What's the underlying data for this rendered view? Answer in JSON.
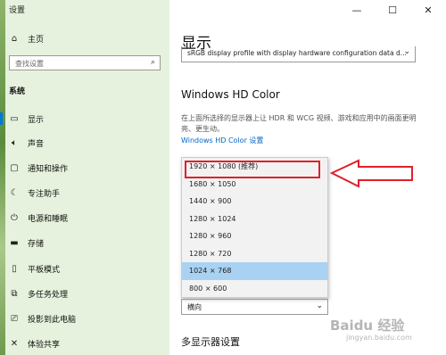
{
  "window": {
    "title": "设置",
    "controls": [
      "—",
      "☐",
      "✕"
    ]
  },
  "sidebar": {
    "home_label": "主页",
    "search_placeholder": "查找设置",
    "section": "系统",
    "items": [
      {
        "icon": "monitor-icon",
        "label": "显示"
      },
      {
        "icon": "speaker-icon",
        "label": "声音"
      },
      {
        "icon": "notification-icon",
        "label": "通知和操作"
      },
      {
        "icon": "moon-icon",
        "label": "专注助手"
      },
      {
        "icon": "power-icon",
        "label": "电源和睡眠"
      },
      {
        "icon": "storage-icon",
        "label": "存储"
      },
      {
        "icon": "tablet-icon",
        "label": "平板模式"
      },
      {
        "icon": "multitask-icon",
        "label": "多任务处理"
      },
      {
        "icon": "project-icon",
        "label": "投影到此电脑"
      },
      {
        "icon": "share-icon",
        "label": "体验共享"
      }
    ]
  },
  "main": {
    "title": "显示",
    "profile_value": "sRGB display profile with display hardware configuration data d...",
    "hd_title": "Windows HD Color",
    "hd_desc": "在上面所选择的显示器上让 HDR 和 WCG 视频、游戏和应用中的画面更明亮、更生动。",
    "hd_link": "Windows HD Color 设置",
    "resolutions": [
      "1920 × 1080 (推荐)",
      "1680 × 1050",
      "1440 × 900",
      "1280 × 1024",
      "1280 × 960",
      "1280 × 720",
      "1024 × 768",
      "800 × 600"
    ],
    "selected_resolution": "1024 × 768",
    "orientation_value": "横向",
    "multi_display_title": "多显示器设置"
  },
  "watermark": {
    "brand": "Baidu 经验",
    "url": "jingyan.baidu.com"
  },
  "colors": {
    "accent": "#0078d7",
    "highlight": "#e0202a",
    "selected": "#a9d2f2",
    "sidebar_bg": "#e6f2dd"
  }
}
